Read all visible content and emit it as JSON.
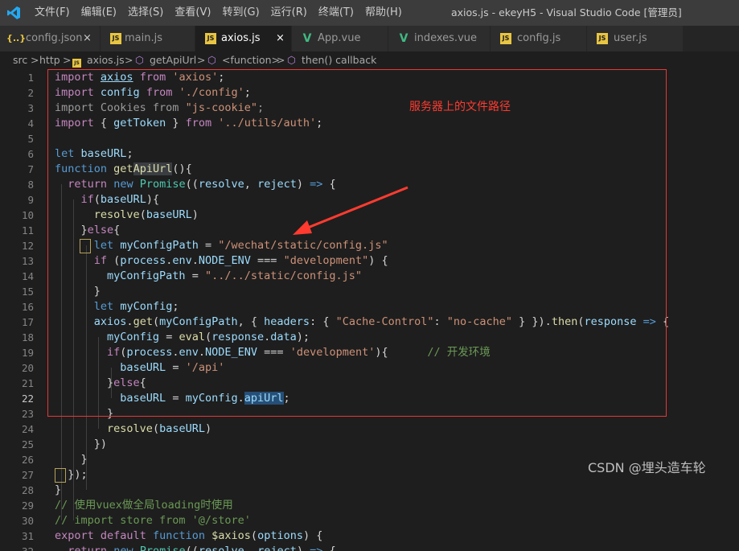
{
  "titlebar": {
    "menu": [
      "文件(F)",
      "编辑(E)",
      "选择(S)",
      "查看(V)",
      "转到(G)",
      "运行(R)",
      "终端(T)",
      "帮助(H)"
    ],
    "window_title": "axios.js - ekeyH5 - Visual Studio Code [管理员]"
  },
  "tabs": [
    {
      "label": "config.json",
      "icon": "json-icon",
      "active": false,
      "close": "×"
    },
    {
      "label": "main.js",
      "icon": "js-icon",
      "active": false
    },
    {
      "label": "axios.js",
      "icon": "js-icon",
      "active": true,
      "close": "×"
    },
    {
      "label": "App.vue",
      "icon": "vue-icon",
      "active": false
    },
    {
      "label": "indexes.vue",
      "icon": "vue-icon",
      "active": false
    },
    {
      "label": "config.js",
      "icon": "js-icon",
      "active": false
    },
    {
      "label": "user.js",
      "icon": "js-icon",
      "active": false
    }
  ],
  "breadcrumb": {
    "items": [
      "src",
      "http",
      "axios.js",
      "getApiUrl",
      "<function>",
      "then() callback"
    ],
    "sep": ">"
  },
  "annotation": "服务器上的文件路径",
  "watermark": "CSDN @埋头造车轮",
  "colors": {
    "keyword": "#569cd6",
    "control": "#c586c0",
    "string": "#ce9178",
    "comment": "#6a9955",
    "function": "#dcdcaa",
    "variable": "#9cdcfe",
    "annotation": "#ff3b30"
  },
  "code_lines": [
    {
      "n": "1",
      "tokens": [
        [
          "c2",
          "import"
        ],
        [
          "o",
          " "
        ],
        [
          "v uline",
          "axios"
        ],
        [
          "o",
          " "
        ],
        [
          "c2",
          "from"
        ],
        [
          "o",
          " "
        ],
        [
          "s",
          "'axios'"
        ],
        [
          "o",
          ";"
        ]
      ]
    },
    {
      "n": "2",
      "tokens": [
        [
          "c2",
          "import"
        ],
        [
          "o",
          " "
        ],
        [
          "v",
          "config"
        ],
        [
          "o",
          " "
        ],
        [
          "c2",
          "from"
        ],
        [
          "o",
          " "
        ],
        [
          "s",
          "'./config'"
        ],
        [
          "o",
          ";"
        ]
      ]
    },
    {
      "n": "3",
      "tokens": [
        [
          "d",
          "import Cookies from "
        ],
        [
          "s",
          "\"js-cookie\""
        ],
        [
          "d",
          ";"
        ]
      ]
    },
    {
      "n": "4",
      "tokens": [
        [
          "c2",
          "import"
        ],
        [
          "o",
          " { "
        ],
        [
          "v",
          "getToken"
        ],
        [
          "o",
          " } "
        ],
        [
          "c2",
          "from"
        ],
        [
          "o",
          " "
        ],
        [
          "s",
          "'../utils/auth'"
        ],
        [
          "o",
          ";"
        ]
      ]
    },
    {
      "n": "5",
      "tokens": []
    },
    {
      "n": "6",
      "tokens": [
        [
          "k",
          "let"
        ],
        [
          "o",
          " "
        ],
        [
          "v",
          "baseURL"
        ],
        [
          "o",
          ";"
        ]
      ]
    },
    {
      "n": "7",
      "tokens": [
        [
          "k",
          "function"
        ],
        [
          "o",
          " "
        ],
        [
          "f",
          "get"
        ],
        [
          "f hl",
          "ApiUrl"
        ],
        [
          "o",
          "(){"
        ]
      ]
    },
    {
      "n": "8",
      "tokens": [
        [
          "o",
          "  "
        ],
        [
          "c2",
          "return"
        ],
        [
          "o",
          " "
        ],
        [
          "k",
          "new"
        ],
        [
          "o",
          " "
        ],
        [
          "t",
          "Promise"
        ],
        [
          "o",
          "(("
        ],
        [
          "v",
          "resolve"
        ],
        [
          "o",
          ", "
        ],
        [
          "v",
          "reject"
        ],
        [
          "o",
          ") "
        ],
        [
          "k",
          "=>"
        ],
        [
          "o",
          " {"
        ]
      ]
    },
    {
      "n": "9",
      "tokens": [
        [
          "o",
          "    "
        ],
        [
          "c2",
          "if"
        ],
        [
          "o",
          "("
        ],
        [
          "v",
          "baseURL"
        ],
        [
          "o",
          "){"
        ]
      ]
    },
    {
      "n": "10",
      "tokens": [
        [
          "o",
          "      "
        ],
        [
          "f",
          "resolve"
        ],
        [
          "o",
          "("
        ],
        [
          "v",
          "baseURL"
        ],
        [
          "o",
          ")"
        ]
      ]
    },
    {
      "n": "11",
      "tokens": [
        [
          "o",
          "    }"
        ],
        [
          "c2",
          "else"
        ],
        [
          "o",
          "{"
        ]
      ]
    },
    {
      "n": "12",
      "tokens": [
        [
          "o",
          "      "
        ],
        [
          "k",
          "let"
        ],
        [
          "o",
          " "
        ],
        [
          "v",
          "myConfigPath"
        ],
        [
          "o",
          " = "
        ],
        [
          "s",
          "\"/wechat/static/config.js\""
        ]
      ]
    },
    {
      "n": "13",
      "tokens": [
        [
          "o",
          "      "
        ],
        [
          "c2",
          "if"
        ],
        [
          "o",
          " ("
        ],
        [
          "v",
          "process"
        ],
        [
          "o",
          "."
        ],
        [
          "v",
          "env"
        ],
        [
          "o",
          "."
        ],
        [
          "v",
          "NODE_ENV"
        ],
        [
          "o",
          " === "
        ],
        [
          "s",
          "\"development\""
        ],
        [
          "o",
          ") {"
        ]
      ]
    },
    {
      "n": "14",
      "tokens": [
        [
          "o",
          "        "
        ],
        [
          "v",
          "myConfigPath"
        ],
        [
          "o",
          " = "
        ],
        [
          "s",
          "\"../../static/config.js\""
        ]
      ]
    },
    {
      "n": "15",
      "tokens": [
        [
          "o",
          "      }"
        ]
      ]
    },
    {
      "n": "16",
      "tokens": [
        [
          "o",
          "      "
        ],
        [
          "k",
          "let"
        ],
        [
          "o",
          " "
        ],
        [
          "v",
          "myConfig"
        ],
        [
          "o",
          ";"
        ]
      ]
    },
    {
      "n": "17",
      "tokens": [
        [
          "o",
          "      "
        ],
        [
          "v",
          "axios"
        ],
        [
          "o",
          "."
        ],
        [
          "f",
          "get"
        ],
        [
          "o",
          "("
        ],
        [
          "v",
          "myConfigPath"
        ],
        [
          "o",
          ", { "
        ],
        [
          "v",
          "headers"
        ],
        [
          "o",
          ": { "
        ],
        [
          "s",
          "\"Cache-Control\""
        ],
        [
          "o",
          ": "
        ],
        [
          "s",
          "\"no-cache\""
        ],
        [
          "o",
          " } })."
        ],
        [
          "f",
          "then"
        ],
        [
          "o",
          "("
        ],
        [
          "v",
          "response"
        ],
        [
          "o",
          " "
        ],
        [
          "k",
          "=>"
        ],
        [
          "o",
          " {"
        ]
      ]
    },
    {
      "n": "18",
      "tokens": [
        [
          "o",
          "        "
        ],
        [
          "v",
          "myConfig"
        ],
        [
          "o",
          " = "
        ],
        [
          "f",
          "eval"
        ],
        [
          "o",
          "("
        ],
        [
          "v",
          "response"
        ],
        [
          "o",
          "."
        ],
        [
          "v",
          "data"
        ],
        [
          "o",
          ");"
        ]
      ]
    },
    {
      "n": "19",
      "tokens": [
        [
          "o",
          "        "
        ],
        [
          "c2",
          "if"
        ],
        [
          "o",
          "("
        ],
        [
          "v",
          "process"
        ],
        [
          "o",
          "."
        ],
        [
          "v",
          "env"
        ],
        [
          "o",
          "."
        ],
        [
          "v",
          "NODE_ENV"
        ],
        [
          "o",
          " === "
        ],
        [
          "s",
          "'development'"
        ],
        [
          "o",
          "){      "
        ],
        [
          "cm",
          "// 开发环境"
        ]
      ]
    },
    {
      "n": "20",
      "tokens": [
        [
          "o",
          "          "
        ],
        [
          "v",
          "baseURL"
        ],
        [
          "o",
          " = "
        ],
        [
          "s",
          "'/api'"
        ]
      ]
    },
    {
      "n": "21",
      "tokens": [
        [
          "o",
          "        }"
        ],
        [
          "c2",
          "else"
        ],
        [
          "o",
          "{"
        ]
      ]
    },
    {
      "n": "22",
      "tokens": [
        [
          "o",
          "          "
        ],
        [
          "v",
          "baseURL"
        ],
        [
          "o",
          " = "
        ],
        [
          "v",
          "myConfig"
        ],
        [
          "o",
          "."
        ],
        [
          "v sel",
          "apiUrl"
        ],
        [
          "o",
          ";"
        ]
      ]
    },
    {
      "n": "23",
      "tokens": [
        [
          "o",
          "        }"
        ]
      ]
    },
    {
      "n": "24",
      "tokens": [
        [
          "o",
          "        "
        ],
        [
          "f",
          "resolve"
        ],
        [
          "o",
          "("
        ],
        [
          "v",
          "baseURL"
        ],
        [
          "o",
          ")"
        ]
      ]
    },
    {
      "n": "25",
      "tokens": [
        [
          "o",
          "      })"
        ]
      ]
    },
    {
      "n": "26",
      "tokens": [
        [
          "o",
          "    }"
        ]
      ]
    },
    {
      "n": "27",
      "tokens": [
        [
          "o",
          "  });"
        ]
      ]
    },
    {
      "n": "28",
      "tokens": [
        [
          "o",
          "}"
        ]
      ]
    },
    {
      "n": "29",
      "tokens": [
        [
          "cm",
          "// 使用vuex做全局loading时使用"
        ]
      ]
    },
    {
      "n": "30",
      "tokens": [
        [
          "cm",
          "// import store from '@/store'"
        ]
      ]
    },
    {
      "n": "31",
      "tokens": [
        [
          "c2",
          "export"
        ],
        [
          "o",
          " "
        ],
        [
          "c2",
          "default"
        ],
        [
          "o",
          " "
        ],
        [
          "k",
          "function"
        ],
        [
          "o",
          " "
        ],
        [
          "f",
          "$axios"
        ],
        [
          "o",
          "("
        ],
        [
          "v",
          "options"
        ],
        [
          "o",
          ") {"
        ]
      ]
    },
    {
      "n": "32",
      "tokens": [
        [
          "o",
          "  "
        ],
        [
          "c2",
          "return"
        ],
        [
          "o",
          " "
        ],
        [
          "k",
          "new"
        ],
        [
          "o",
          " "
        ],
        [
          "t",
          "Promise"
        ],
        [
          "o",
          "(("
        ],
        [
          "v",
          "resolve"
        ],
        [
          "o",
          ", "
        ],
        [
          "v",
          "reject"
        ],
        [
          "o",
          ") "
        ],
        [
          "k",
          "=>"
        ],
        [
          "o",
          " {"
        ]
      ]
    }
  ],
  "current_line": "22"
}
